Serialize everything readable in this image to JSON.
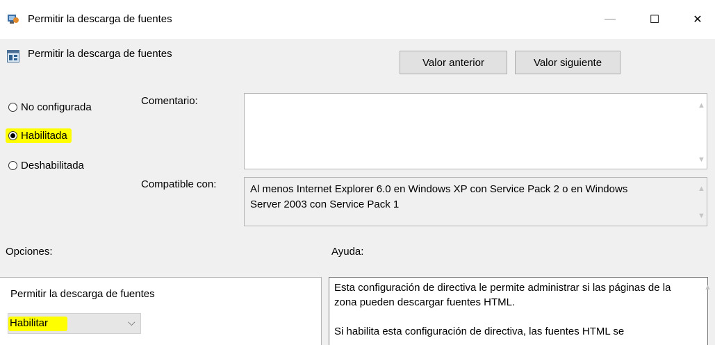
{
  "window": {
    "title": "Permitir la descarga de fuentes",
    "minimize": "—",
    "maximize": "☐",
    "close": "✕"
  },
  "policy": {
    "title": "Permitir la descarga de fuentes",
    "prev_button": "Valor anterior",
    "next_button": "Valor siguiente"
  },
  "state": {
    "options": [
      {
        "label": "No configurada",
        "selected": false
      },
      {
        "label": "Habilitada",
        "selected": true
      },
      {
        "label": "Deshabilitada",
        "selected": false
      }
    ]
  },
  "comment": {
    "label": "Comentario:",
    "value": ""
  },
  "compat": {
    "label": "Compatible con:",
    "text": "Al menos Internet Explorer 6.0 en Windows XP con Service Pack 2 o en Windows Server 2003 con Service Pack 1"
  },
  "options_section": {
    "label": "Opciones:",
    "field_label": "Permitir la descarga de fuentes",
    "select_value": "Habilitar"
  },
  "help_section": {
    "label": "Ayuda:",
    "para1": "Esta configuración de directiva le permite administrar si las páginas de la zona pueden descargar fuentes HTML.",
    "para2": "Si habilita esta configuración de directiva, las fuentes HTML se"
  },
  "colors": {
    "highlight": "#fefe00",
    "background": "#f0f0f0"
  }
}
